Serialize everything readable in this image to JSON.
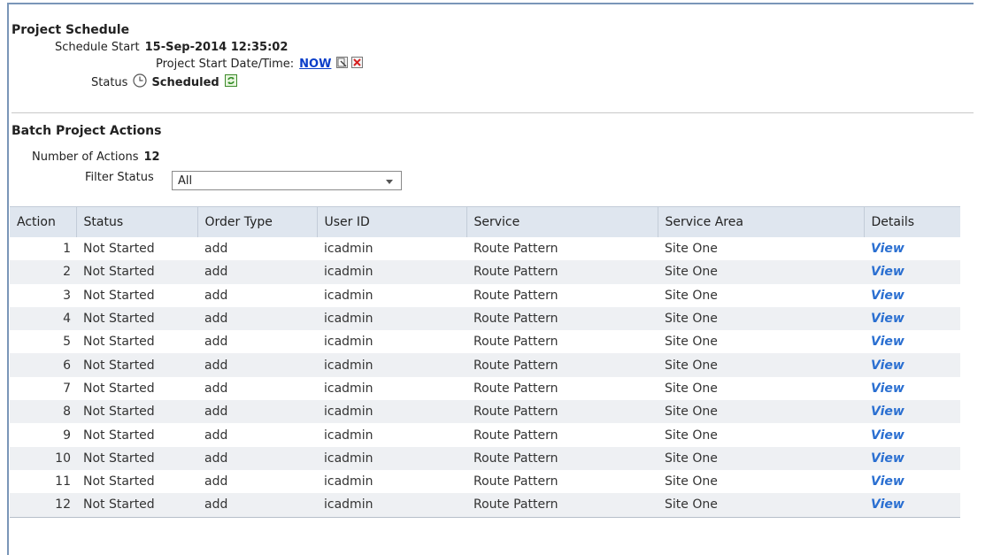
{
  "project_schedule": {
    "title": "Project Schedule",
    "schedule_start_label": "Schedule Start",
    "schedule_start_value": "15-Sep-2014 12:35:02",
    "project_start_label": "Project Start Date/Time:",
    "project_start_link": "NOW",
    "status_label": "Status",
    "status_value": "Scheduled",
    "icons": [
      "edit-schedule-icon",
      "delete-schedule-icon",
      "clock-icon",
      "refresh-icon"
    ]
  },
  "batch_actions": {
    "title": "Batch Project Actions",
    "number_label": "Number of Actions",
    "number_value": "12",
    "filter_label": "Filter Status",
    "filter_value": "All"
  },
  "table": {
    "headers": [
      "Action",
      "Status",
      "Order Type",
      "User ID",
      "Service",
      "Service Area",
      "Details"
    ],
    "rows": [
      [
        "1",
        "Not Started",
        "add",
        "icadmin",
        "Route Pattern",
        "Site One",
        "View"
      ],
      [
        "2",
        "Not Started",
        "add",
        "icadmin",
        "Route Pattern",
        "Site One",
        "View"
      ],
      [
        "3",
        "Not Started",
        "add",
        "icadmin",
        "Route Pattern",
        "Site One",
        "View"
      ],
      [
        "4",
        "Not Started",
        "add",
        "icadmin",
        "Route Pattern",
        "Site One",
        "View"
      ],
      [
        "5",
        "Not Started",
        "add",
        "icadmin",
        "Route Pattern",
        "Site One",
        "View"
      ],
      [
        "6",
        "Not Started",
        "add",
        "icadmin",
        "Route Pattern",
        "Site One",
        "View"
      ],
      [
        "7",
        "Not Started",
        "add",
        "icadmin",
        "Route Pattern",
        "Site One",
        "View"
      ],
      [
        "8",
        "Not Started",
        "add",
        "icadmin",
        "Route Pattern",
        "Site One",
        "View"
      ],
      [
        "9",
        "Not Started",
        "add",
        "icadmin",
        "Route Pattern",
        "Site One",
        "View"
      ],
      [
        "10",
        "Not Started",
        "add",
        "icadmin",
        "Route Pattern",
        "Site One",
        "View"
      ],
      [
        "11",
        "Not Started",
        "add",
        "icadmin",
        "Route Pattern",
        "Site One",
        "View"
      ],
      [
        "12",
        "Not Started",
        "add",
        "icadmin",
        "Route Pattern",
        "Site One",
        "View"
      ]
    ]
  },
  "colors": {
    "frame": "#7a96b8",
    "header_bg": "#dfe6ef",
    "alt_row_bg": "#eef0f3",
    "link": "#0a3ec9",
    "view_link": "#2a6fd1"
  }
}
